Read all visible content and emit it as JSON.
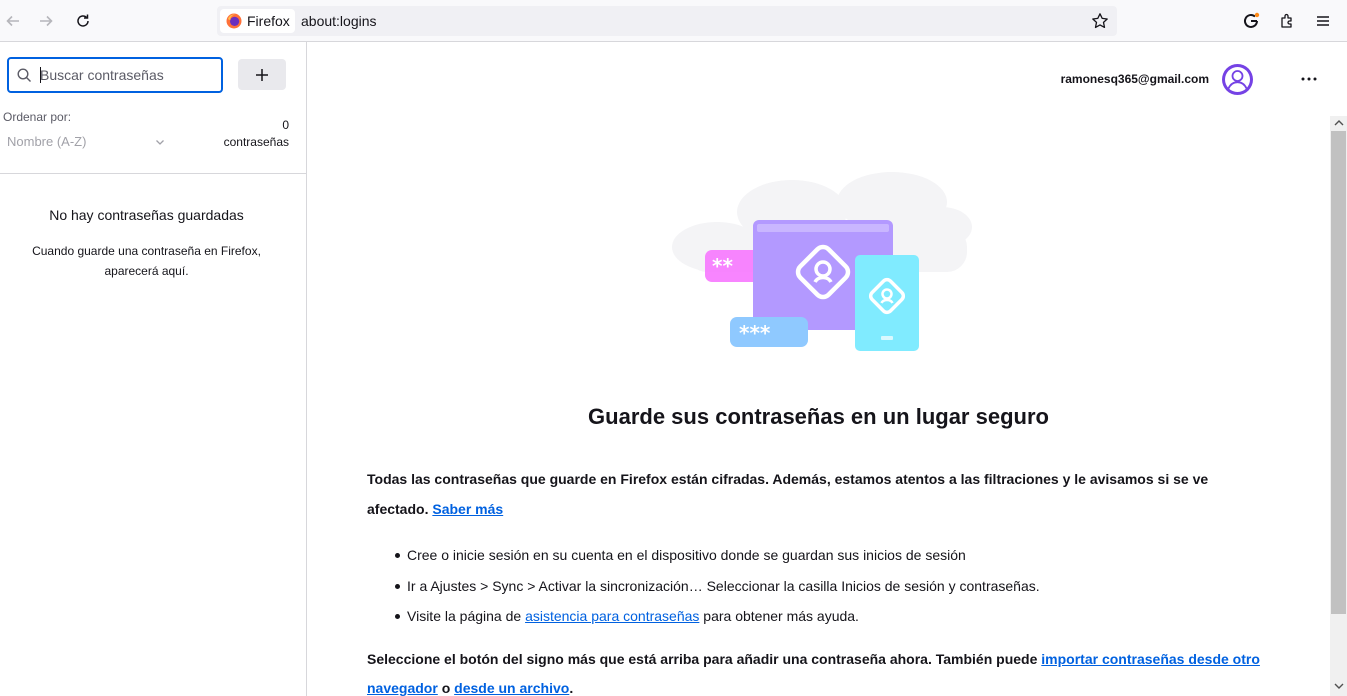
{
  "toolbar": {
    "identity_label": "Firefox",
    "url": "about:logins"
  },
  "sidebar": {
    "search_placeholder": "Buscar contraseñas",
    "add_label": "+",
    "sort_label": "Ordenar por:",
    "sort_value": "Nombre (A-Z)",
    "count_number": "0",
    "count_label": "contraseñas",
    "empty_title": "No hay contraseñas guardadas",
    "empty_desc": "Cuando guarde una contraseña en Firefox, aparecerá aquí."
  },
  "main": {
    "account_email": "ramonesq365@gmail.com",
    "heading": "Guarde sus contraseñas en un lugar seguro",
    "intro_text": "Todas las contraseñas que guarde en Firefox están cifradas. Además, estamos atentos a las filtraciones y le avisamos si se ve afectado.",
    "learn_more": "Saber más",
    "bullet_1": "Cree o inicie sesión en su cuenta en el dispositivo donde se guardan sus inicios de sesión",
    "bullet_2": "Ir a Ajustes > Sync > Activar la sincronización… Seleccionar la casilla Inicios de sesión y contraseñas.",
    "bullet_3_pre": "Visite la página de",
    "bullet_3_link": "asistencia para contraseñas",
    "bullet_3_post": "para obtener más ayuda.",
    "final_pre": "Seleccione el botón del signo más que está arriba para añadir una contraseña ahora. También puede",
    "final_link_1": "importar contraseñas desde otro navegador",
    "final_mid": "o",
    "final_link_2": "desde un archivo",
    "final_post": "."
  },
  "colors": {
    "accent": "#0061e0",
    "avatar": "#7542e5"
  },
  "icons": [
    "back-arrow-icon",
    "forward-arrow-icon",
    "reload-icon",
    "firefox-logo-icon",
    "bookmark-star-icon",
    "account-icon",
    "extensions-icon",
    "hamburger-menu-icon",
    "search-icon",
    "chevron-down-icon",
    "more-dots-icon",
    "avatar-icon"
  ]
}
